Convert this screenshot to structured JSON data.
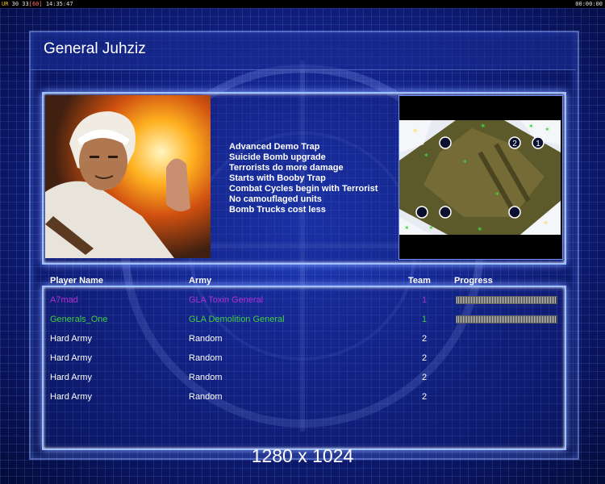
{
  "debug": {
    "left_a": "UR",
    "left_b": "30 33",
    "left_c": "[60]",
    "left_time": "14:35:47",
    "right_time": "00:00:00"
  },
  "title": "General Juhziz",
  "traits": [
    "Advanced Demo Trap",
    "Suicide Bomb upgrade",
    "Terrorists do more damage",
    "Starts with Booby Trap",
    "Combat Cycles begin with Terrorist",
    "No camouflaged units",
    "Bomb Trucks cost less"
  ],
  "minimap": {
    "start_labels": [
      "2",
      "1"
    ]
  },
  "columns": {
    "player_name": "Player Name",
    "army": "Army",
    "team": "Team",
    "progress": "Progress"
  },
  "players": [
    {
      "name": "A7mad",
      "army": "GLA Toxin General",
      "team": "1",
      "color": "#b030d0",
      "progress": 1.0
    },
    {
      "name": "Generals_One",
      "army": "GLA Demolition General",
      "team": "1",
      "color": "#40d040",
      "progress": 1.0
    },
    {
      "name": "Hard Army",
      "army": "Random",
      "team": "2",
      "color": "#ffffff"
    },
    {
      "name": "Hard Army",
      "army": "Random",
      "team": "2",
      "color": "#ffffff"
    },
    {
      "name": "Hard Army",
      "army": "Random",
      "team": "2",
      "color": "#ffffff"
    },
    {
      "name": "Hard Army",
      "army": "Random",
      "team": "2",
      "color": "#ffffff"
    }
  ],
  "resolution": "1280 x 1024",
  "colors": {
    "background": "#13238a",
    "panel_border": "#9fc0ff",
    "text": "#ffffff"
  }
}
